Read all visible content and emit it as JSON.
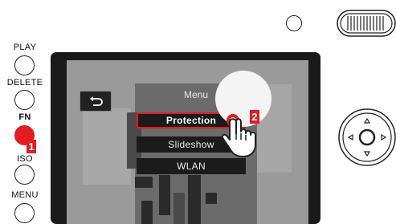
{
  "side_buttons": [
    {
      "label": "PLAY",
      "active": false
    },
    {
      "label": "DELETE",
      "active": false
    },
    {
      "label": "FN",
      "active": true
    },
    {
      "label": "ISO",
      "active": false
    },
    {
      "label": "MENU",
      "active": false
    }
  ],
  "callouts": {
    "fn_step": "1",
    "tap_step": "2"
  },
  "menu": {
    "title": "Menu",
    "items": [
      {
        "label": "Protection",
        "selected": true
      },
      {
        "label": "Slideshow",
        "selected": false
      },
      {
        "label": "WLAN",
        "selected": false
      }
    ]
  },
  "colors": {
    "accent": "#e31b23",
    "screen_bg": "#9a9a9a",
    "menu_item_bg": "#1b1b1b"
  },
  "icons": [
    "back-arrow-icon",
    "tap-hand-icon",
    "thumbwheel-icon",
    "dial-button-icon",
    "four-way-selector-icon"
  ]
}
